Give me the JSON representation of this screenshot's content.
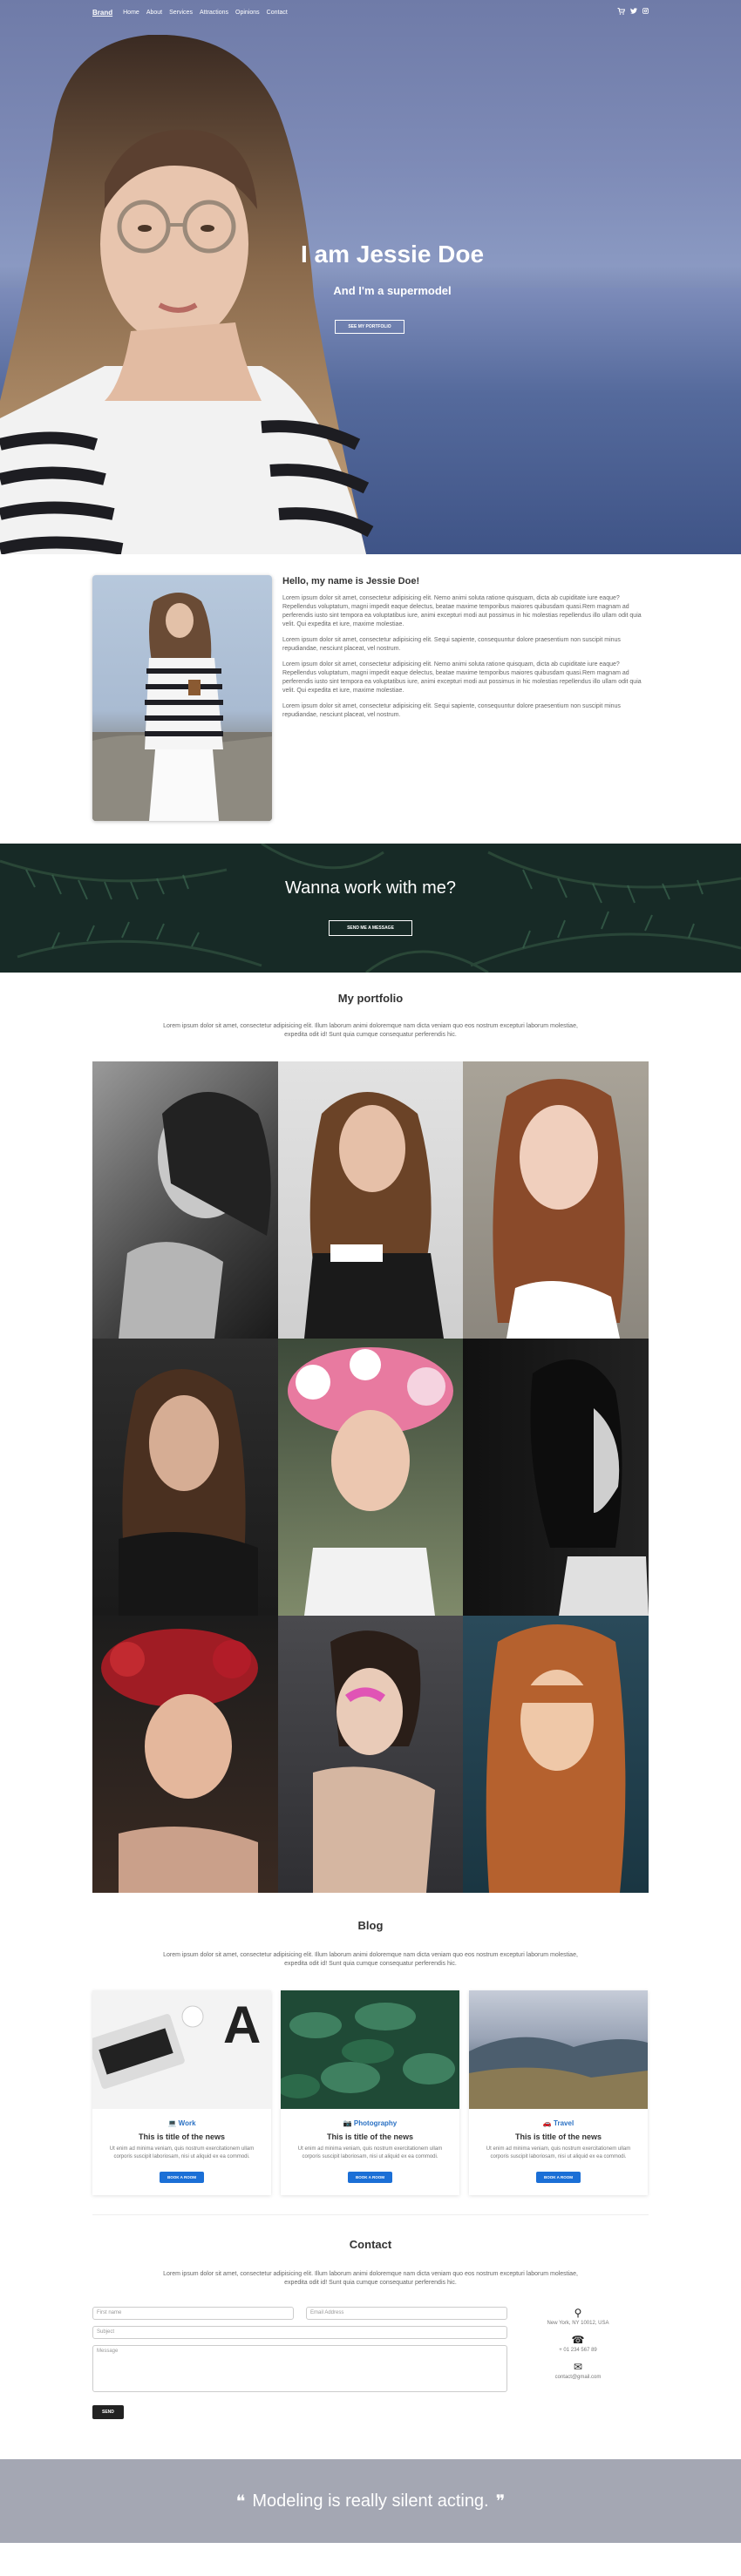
{
  "nav": {
    "brand": "Brand",
    "links": [
      "Home",
      "About",
      "Services",
      "Attractions",
      "Opinions",
      "Contact"
    ],
    "icons": [
      "cart-icon",
      "twitter-icon",
      "instagram-icon"
    ]
  },
  "hero": {
    "title": "I am Jessie Doe",
    "subtitle": "And I'm a supermodel",
    "button": "SEE MY PORTFOLIO"
  },
  "about": {
    "title": "Hello, my name is Jessie Doe!",
    "paragraphs": [
      "Lorem ipsum dolor sit amet, consectetur adipisicing elit. Nemo animi soluta ratione quisquam, dicta ab cupiditate iure eaque? Repellendus voluptatum, magni impedit eaque delectus, beatae maxime temporibus maiores quibusdam quasi.Rem magnam ad perferendis iusto sint tempora ea voluptatibus iure, animi excepturi modi aut possimus in hic molestias repellendus illo ullam odit quia velit. Qui expedita et iure, maxime molestiae.",
      "Lorem ipsum dolor sit amet, consectetur adipisicing elit. Sequi sapiente, consequuntur dolore praesentium non suscipit minus repudiandae, nesciunt placeat, vel nostrum.",
      "Lorem ipsum dolor sit amet, consectetur adipisicing elit. Nemo animi soluta ratione quisquam, dicta ab cupiditate iure eaque? Repellendus voluptatum, magni impedit eaque delectus, beatae maxime temporibus maiores quibusdam quasi.Rem magnam ad perferendis iusto sint tempora ea voluptatibus iure, animi excepturi modi aut possimus in hic molestias repellendus illo ullam odit quia velit. Qui expedita et iure, maxime molestiae.",
      "Lorem ipsum dolor sit amet, consectetur adipisicing elit. Sequi sapiente, consequuntur dolore praesentium non suscipit minus repudiandae, nesciunt placeat, vel nostrum."
    ]
  },
  "cta": {
    "title": "Wanna work with me?",
    "button": "SEND ME A MESSAGE"
  },
  "portfolio": {
    "title": "My portfolio",
    "description": "Lorem ipsum dolor sit amet, consectetur adipisicing elit. Illum laborum animi doloremque nam dicta veniam quo eos nostrum excepturi laborum molestiae, expedita odit id! Sunt quia cumque consequatur perferendis hic."
  },
  "blog": {
    "title": "Blog",
    "description": "Lorem ipsum dolor sit amet, consectetur adipisicing elit. Illum laborum animi doloremque nam dicta veniam quo eos nostrum excepturi laborum molestiae, expedita odit id! Sunt quia cumque consequatur perferendis hic.",
    "cards": [
      {
        "category": "Work",
        "icon": "laptop-icon",
        "title": "This is title of the news",
        "text": "Ut enim ad minima veniam, quis nostrum exercitationem ullam corporis suscipit laboriosam, nisi ut aliquid ex ea commodi.",
        "button": "BOOK A ROOM"
      },
      {
        "category": "Photography",
        "icon": "camera-icon",
        "title": "This is title of the news",
        "text": "Ut enim ad minima veniam, quis nostrum exercitationem ullam corporis suscipit laboriosam, nisi ut aliquid ex ea commodi.",
        "button": "BOOK A ROOM"
      },
      {
        "category": "Travel",
        "icon": "car-icon",
        "title": "This is title of the news",
        "text": "Ut enim ad minima veniam, quis nostrum exercitationem ullam corporis suscipit laboriosam, nisi ut aliquid ex ea commodi.",
        "button": "BOOK A ROOM"
      }
    ]
  },
  "contact": {
    "title": "Contact",
    "description": "Lorem ipsum dolor sit amet, consectetur adipisicing elit. Illum laborum animi doloremque nam dicta veniam quo eos nostrum excepturi laborum molestiae, expedita odit id! Sunt quia cumque consequatur perferendis hic.",
    "first_name_placeholder": "First name",
    "email_placeholder": "Email Address",
    "subject_placeholder": "Subject",
    "message_placeholder": "Message",
    "send_label": "SEND",
    "address": "New York, NY 10012, USA",
    "phone": "+ 01 234 567 89",
    "email": "contact@gmail.com"
  },
  "quote": {
    "text": "Modeling is really silent acting."
  },
  "colors": {
    "accent_blue": "#1b6fd6",
    "quote_bg": "#a4a7b3",
    "cta_bg": "#172a26"
  }
}
